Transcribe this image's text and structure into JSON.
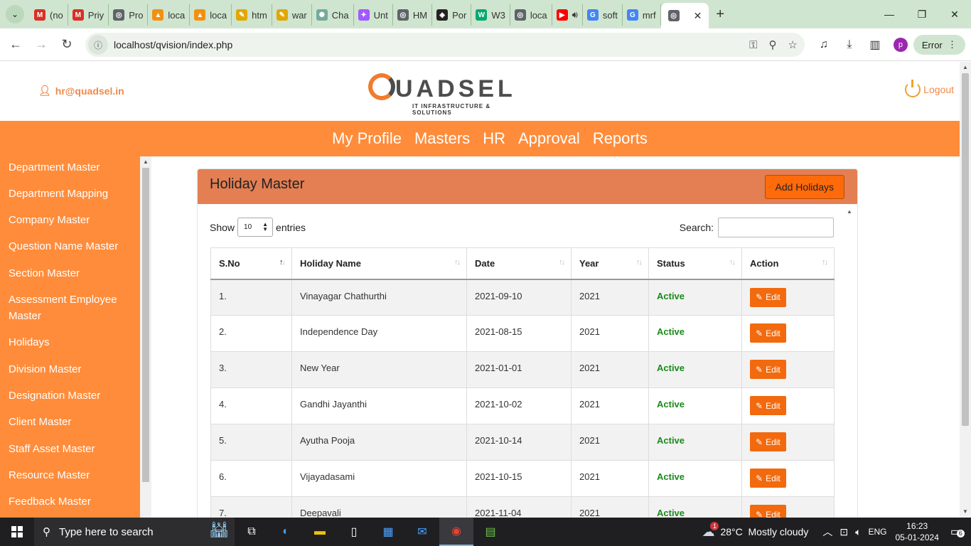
{
  "browser": {
    "tabs": [
      {
        "label": "(no",
        "icon": "gmail-icon",
        "color": "#d93025",
        "glyph": "M"
      },
      {
        "label": "Priy",
        "icon": "gmail-icon",
        "color": "#d93025",
        "glyph": "M"
      },
      {
        "label": "Pro",
        "icon": "globe-icon",
        "color": "#5f6368",
        "glyph": "◎"
      },
      {
        "label": "loca",
        "icon": "phpmyadmin-icon",
        "color": "#f29111",
        "glyph": "▲"
      },
      {
        "label": "loca",
        "icon": "phpmyadmin-icon",
        "color": "#f29111",
        "glyph": "▲"
      },
      {
        "label": "htm",
        "icon": "pen-icon",
        "color": "#e0a800",
        "glyph": "✎"
      },
      {
        "label": "war",
        "icon": "pen-icon",
        "color": "#e0a800",
        "glyph": "✎"
      },
      {
        "label": "Cha",
        "icon": "chatgpt-icon",
        "color": "#74aa9c",
        "glyph": "✺"
      },
      {
        "label": "Unt",
        "icon": "figma-icon",
        "color": "#a259ff",
        "glyph": "✦"
      },
      {
        "label": "HM",
        "icon": "globe-icon",
        "color": "#5f6368",
        "glyph": "◎"
      },
      {
        "label": "Por",
        "icon": "codepen-icon",
        "color": "#222222",
        "glyph": "◈"
      },
      {
        "label": "W3",
        "icon": "w3schools-icon",
        "color": "#04aa6d",
        "glyph": "W"
      },
      {
        "label": "loca",
        "icon": "globe-icon",
        "color": "#5f6368",
        "glyph": "◎"
      },
      {
        "label": "",
        "icon": "youtube-icon",
        "color": "#ff0000",
        "glyph": "▶"
      },
      {
        "label": "soft",
        "icon": "google-icon",
        "color": "#4285f4",
        "glyph": "G"
      },
      {
        "label": "mrf",
        "icon": "google-icon",
        "color": "#4285f4",
        "glyph": "G"
      }
    ],
    "active_tab_icon": "globe-icon",
    "url": "localhost/qvision/index.php",
    "error_label": "Error",
    "profile_initial": "p"
  },
  "header": {
    "user_email": "hr@quadsel.in",
    "logo_text": "UADSEL",
    "logo_subtitle": "IT INFRASTRUCTURE & SOLUTIONS",
    "logout_label": "Logout"
  },
  "topnav": [
    "My Profile",
    "Masters",
    "HR",
    "Approval",
    "Reports"
  ],
  "sidebar": [
    "Department Master",
    "Department Mapping",
    "Company Master",
    "Question Name Master",
    "Section Master",
    "Assessment Employee Master",
    "Holidays",
    "Division Master",
    "Designation Master",
    "Client Master",
    "Staff Asset Master",
    "Resource Master",
    "Feedback Master"
  ],
  "card": {
    "title": "Holiday Master",
    "add_button": "Add Holidays",
    "show_label": "Show",
    "entries_value": "10",
    "entries_label": "entries",
    "search_label": "Search:"
  },
  "table": {
    "columns": [
      "S.No",
      "Holiday Name",
      "Date",
      "Year",
      "Status",
      "Action"
    ],
    "edit_label": "Edit",
    "rows": [
      {
        "sno": "1.",
        "name": "Vinayagar Chathurthi",
        "date": "2021-09-10",
        "year": "2021",
        "status": "Active"
      },
      {
        "sno": "2.",
        "name": "Independence Day",
        "date": "2021-08-15",
        "year": "2021",
        "status": "Active"
      },
      {
        "sno": "3.",
        "name": "New Year",
        "date": "2021-01-01",
        "year": "2021",
        "status": "Active"
      },
      {
        "sno": "4.",
        "name": "Gandhi Jayanthi",
        "date": "2021-10-02",
        "year": "2021",
        "status": "Active"
      },
      {
        "sno": "5.",
        "name": "Ayutha Pooja",
        "date": "2021-10-14",
        "year": "2021",
        "status": "Active"
      },
      {
        "sno": "6.",
        "name": "Vijayadasami",
        "date": "2021-10-15",
        "year": "2021",
        "status": "Active"
      },
      {
        "sno": "7.",
        "name": "Deepavali",
        "date": "2021-11-04",
        "year": "2021",
        "status": "Active"
      }
    ]
  },
  "taskbar": {
    "search_placeholder": "Type here to search",
    "weather": "28°C  Mostly cloudy",
    "language": "ENG",
    "time": "16:23",
    "date": "05-01-2024",
    "notification_count": "6",
    "weather_badge": "1"
  },
  "colors": {
    "brand_orange": "#ff8c3a",
    "card_header": "#e37f53",
    "status_active": "#1a8a1a",
    "edit_button": "#f26a0d"
  }
}
